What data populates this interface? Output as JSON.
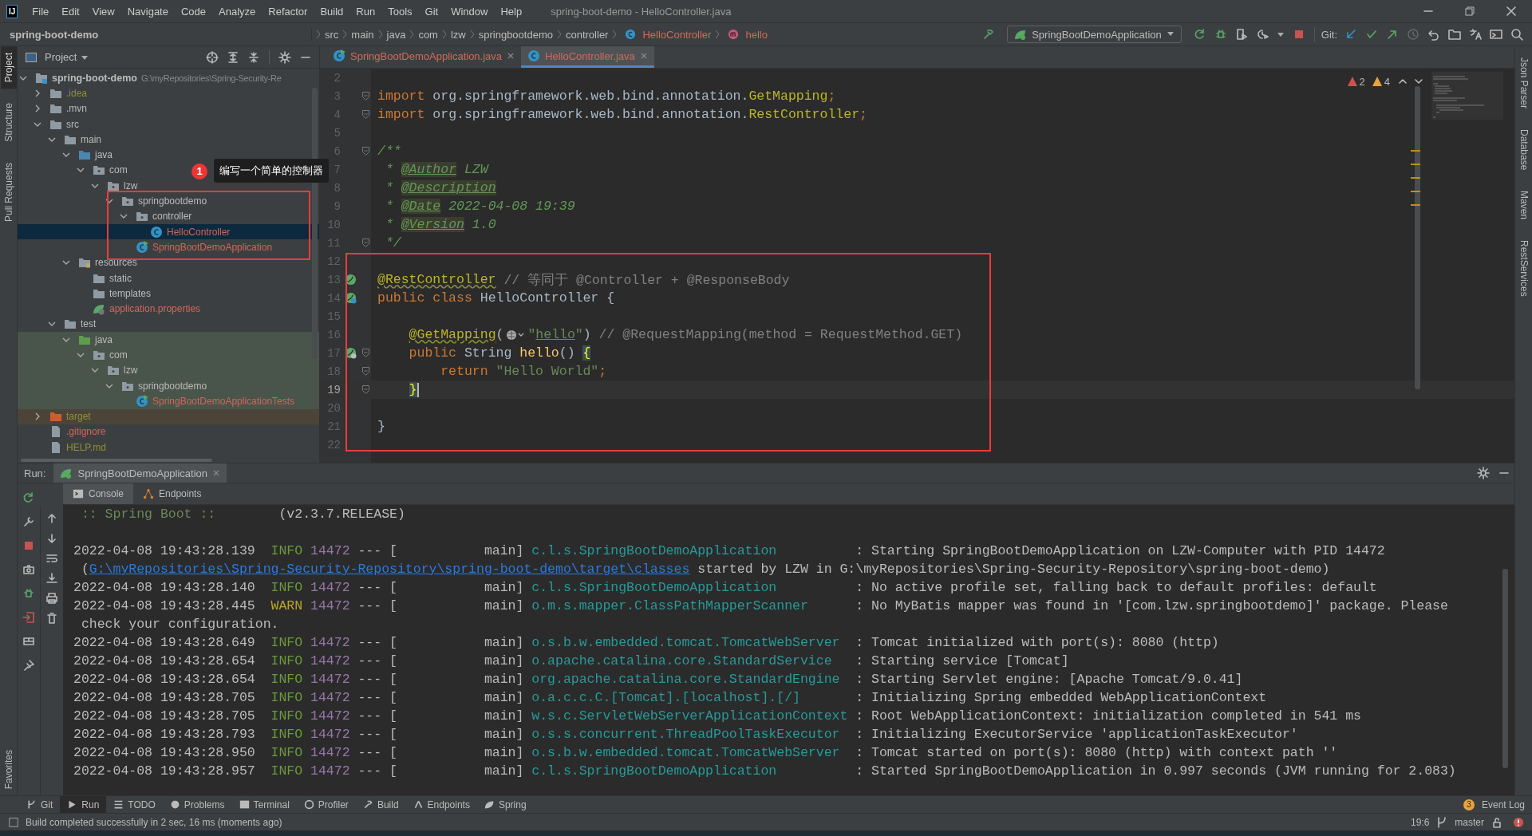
{
  "menu_bar": {
    "logo": "IJ",
    "items": [
      "File",
      "Edit",
      "View",
      "Navigate",
      "Code",
      "Analyze",
      "Refactor",
      "Build",
      "Run",
      "Tools",
      "Git",
      "Window",
      "Help"
    ],
    "title": "spring-boot-demo - HelloController.java"
  },
  "breadcrumbs": [
    {
      "label": "spring-boot-demo",
      "kind": "project"
    },
    {
      "label": "src",
      "kind": "folder"
    },
    {
      "label": "main",
      "kind": "folder"
    },
    {
      "label": "java",
      "kind": "folder"
    },
    {
      "label": "com",
      "kind": "folder"
    },
    {
      "label": "lzw",
      "kind": "folder"
    },
    {
      "label": "springbootdemo",
      "kind": "folder"
    },
    {
      "label": "controller",
      "kind": "folder"
    },
    {
      "label": "HelloController",
      "kind": "class"
    },
    {
      "label": "hello",
      "kind": "method"
    }
  ],
  "toolbar": {
    "run_config": "SpringBootDemoApplication",
    "git_label": "Git:"
  },
  "left_strip": {
    "top": [
      {
        "label": "Project",
        "selected": true
      },
      {
        "label": "Structure",
        "selected": false
      },
      {
        "label": "Pull Requests",
        "selected": false
      }
    ],
    "bottom": [
      {
        "label": "Favorites",
        "selected": false
      }
    ]
  },
  "right_strip": [
    {
      "label": "Json Parser",
      "selected": false
    },
    {
      "label": "Database",
      "selected": false
    },
    {
      "label": "Maven",
      "selected": false
    },
    {
      "label": "RestServices",
      "selected": false
    }
  ],
  "project_panel": {
    "title": "Project",
    "tree": [
      {
        "name": "spring-boot-demo",
        "path": "G:\\myRepositories\\Spring-Security-Re",
        "kind": "module",
        "expanded": true,
        "selected": false,
        "children": [
          {
            "name": ".idea",
            "kind": "folder",
            "ignored": true,
            "expanded": false,
            "selected": false
          },
          {
            "name": ".mvn",
            "kind": "folder",
            "expanded": false,
            "selected": false
          },
          {
            "name": "src",
            "kind": "folder",
            "expanded": true,
            "selected": false,
            "children": [
              {
                "name": "main",
                "kind": "folder",
                "expanded": true,
                "selected": false,
                "children": [
                  {
                    "name": "java",
                    "kind": "source-root",
                    "expanded": true,
                    "selected": false,
                    "children": [
                      {
                        "name": "com",
                        "kind": "package",
                        "expanded": true,
                        "selected": false,
                        "children": [
                          {
                            "name": "lzw",
                            "kind": "package",
                            "expanded": true,
                            "selected": false,
                            "children": [
                              {
                                "name": "springbootdemo",
                                "kind": "package",
                                "expanded": true,
                                "selected": false,
                                "children": [
                                  {
                                    "name": "controller",
                                    "kind": "package",
                                    "expanded": true,
                                    "selected": false,
                                    "children": [
                                      {
                                        "name": "HelloController",
                                        "kind": "class",
                                        "untracked": true,
                                        "selected": true
                                      }
                                    ]
                                  },
                                  {
                                    "name": "SpringBootDemoApplication",
                                    "kind": "spring-class",
                                    "untracked": true,
                                    "selected": false
                                  }
                                ]
                              }
                            ]
                          }
                        ]
                      }
                    ]
                  },
                  {
                    "name": "resources",
                    "kind": "resources-root",
                    "expanded": true,
                    "selected": false,
                    "children": [
                      {
                        "name": "static",
                        "kind": "folder",
                        "selected": false
                      },
                      {
                        "name": "templates",
                        "kind": "folder",
                        "selected": false
                      },
                      {
                        "name": "application.properties",
                        "kind": "spring-properties",
                        "untracked": true,
                        "selected": false
                      }
                    ]
                  }
                ]
              },
              {
                "name": "test",
                "kind": "folder",
                "expanded": true,
                "selected": false,
                "children": [
                  {
                    "name": "java",
                    "kind": "test-root",
                    "in_test": true,
                    "expanded": true,
                    "selected": false,
                    "children": [
                      {
                        "name": "com",
                        "kind": "package",
                        "in_test": true,
                        "expanded": true,
                        "selected": false,
                        "children": [
                          {
                            "name": "lzw",
                            "kind": "package",
                            "in_test": true,
                            "expanded": true,
                            "selected": false,
                            "children": [
                              {
                                "name": "springbootdemo",
                                "kind": "package",
                                "in_test": true,
                                "expanded": true,
                                "selected": false,
                                "children": [
                                  {
                                    "name": "SpringBootDemoApplicationTests",
                                    "kind": "spring-class",
                                    "in_test": true,
                                    "untracked": true,
                                    "selected": false
                                  }
                                ]
                              }
                            ]
                          }
                        ]
                      }
                    ]
                  }
                ]
              }
            ]
          },
          {
            "name": "target",
            "kind": "excluded",
            "ignored": true,
            "expanded": false,
            "selected": false
          },
          {
            "name": ".gitignore",
            "kind": "ignore-file",
            "untracked": true,
            "selected": false
          },
          {
            "name": "HELP.md",
            "kind": "md-file",
            "ignored": true,
            "selected": false
          }
        ]
      }
    ]
  },
  "annotations": [
    {
      "number": "1",
      "text": "编写一个简单的控制器"
    }
  ],
  "editor": {
    "tabs": [
      {
        "label": "SpringBootDemoApplication.java",
        "kind": "spring-class",
        "selected": false
      },
      {
        "label": "HelloController.java",
        "kind": "class",
        "selected": true
      }
    ],
    "problems": [
      {
        "count": "2",
        "kind": "error"
      },
      {
        "count": "4",
        "kind": "warning"
      }
    ],
    "lines": [
      {
        "number": "2"
      },
      {
        "number": "3",
        "fold": true,
        "tokens": [
          {
            "text": "import",
            "kind": "kw"
          },
          {
            "text": " org.springframework.web.bind.annotation.",
            "kind": "plain"
          },
          {
            "text": "GetMapping",
            "kind": "ann"
          },
          {
            "text": ";",
            "kind": "kw"
          }
        ]
      },
      {
        "number": "4",
        "fold": true,
        "tokens": [
          {
            "text": "import",
            "kind": "kw"
          },
          {
            "text": " org.springframework.web.bind.annotation.",
            "kind": "plain"
          },
          {
            "text": "RestController",
            "kind": "ann"
          },
          {
            "text": ";",
            "kind": "kw"
          }
        ]
      },
      {
        "number": "5"
      },
      {
        "number": "6",
        "fold": true,
        "tokens": [
          {
            "text": "/**",
            "kind": "doc"
          }
        ]
      },
      {
        "number": "7",
        "tokens": [
          {
            "text": " * ",
            "kind": "doc"
          },
          {
            "text": "@Author",
            "kind": "doctag"
          },
          {
            "text": " LZW",
            "kind": "doc"
          }
        ]
      },
      {
        "number": "8",
        "tokens": [
          {
            "text": " * ",
            "kind": "doc"
          },
          {
            "text": "@Description",
            "kind": "doctag"
          }
        ]
      },
      {
        "number": "9",
        "tokens": [
          {
            "text": " * ",
            "kind": "doc"
          },
          {
            "text": "@Date",
            "kind": "doctag"
          },
          {
            "text": " 2022-04-08 19:39",
            "kind": "doc"
          }
        ]
      },
      {
        "number": "10",
        "tokens": [
          {
            "text": " * ",
            "kind": "doc"
          },
          {
            "text": "@Version",
            "kind": "doctag"
          },
          {
            "text": " 1.0",
            "kind": "doc"
          }
        ]
      },
      {
        "number": "11",
        "fold": true,
        "tokens": [
          {
            "text": " */",
            "kind": "doc"
          }
        ]
      },
      {
        "number": "12"
      },
      {
        "number": "13",
        "gutter": {
          "kind": "bean"
        },
        "tokens": [
          {
            "text": "@RestController",
            "kind": "ann-wavy"
          },
          {
            "text": " // 等同于 @Controller + @ResponseBody",
            "kind": "cm"
          }
        ]
      },
      {
        "number": "14",
        "gutter": {
          "kind": "bean-linked"
        },
        "tokens": [
          {
            "text": "public class ",
            "kind": "kw"
          },
          {
            "text": "HelloController {",
            "kind": "plain"
          }
        ]
      },
      {
        "number": "15"
      },
      {
        "number": "16",
        "tokens": [
          {
            "text": "    @GetMapping",
            "kind": "ann-wavy"
          },
          {
            "text": "(",
            "kind": "plain"
          },
          {
            "kind": "inlay"
          },
          {
            "text": "\"",
            "kind": "str"
          },
          {
            "text": "hello",
            "kind": "str-link"
          },
          {
            "text": "\"",
            "kind": "str"
          },
          {
            "text": ")",
            "kind": "plain"
          },
          {
            "text": " // @RequestMapping(method = RequestMethod.GET)",
            "kind": "cm"
          }
        ]
      },
      {
        "number": "17",
        "gutter": {
          "kind": "web"
        },
        "fold": true,
        "tokens": [
          {
            "text": "    public ",
            "kind": "kw"
          },
          {
            "text": "String ",
            "kind": "plain"
          },
          {
            "text": "hello",
            "kind": "fn"
          },
          {
            "text": "() ",
            "kind": "plain"
          },
          {
            "text": "{",
            "kind": "brace"
          }
        ]
      },
      {
        "number": "18",
        "fold": true,
        "tokens": [
          {
            "text": "        return ",
            "kind": "kw"
          },
          {
            "text": "\"Hello World\"",
            "kind": "str"
          },
          {
            "text": ";",
            "kind": "kw"
          }
        ]
      },
      {
        "number": "19",
        "fold": true,
        "current": true,
        "tokens": [
          {
            "text": "    }",
            "kind": "brace"
          }
        ]
      },
      {
        "number": "20"
      },
      {
        "number": "21",
        "tokens": [
          {
            "text": "}",
            "kind": "plain"
          }
        ]
      },
      {
        "number": "22"
      }
    ]
  },
  "run_panel": {
    "label": "Run:",
    "tab": "SpringBootDemoApplication",
    "subtabs": [
      {
        "label": "Console",
        "kind": "console",
        "selected": true
      },
      {
        "label": "Endpoints",
        "kind": "endpoints",
        "selected": false
      }
    ],
    "console": [
      {
        "kind": "banner",
        "name": ":: Spring Boot ::",
        "version": "(v2.3.7.RELEASE)"
      },
      {
        "kind": "blank"
      },
      {
        "kind": "log",
        "time": "2022-04-08 19:43:28.139",
        "level": "INFO",
        "pid": "14472",
        "thread": "--- [           main]",
        "logger": "c.l.s.SpringBootDemoApplication",
        "message": ": Starting SpringBootDemoApplication on LZW-Computer with PID 14472"
      },
      {
        "kind": "cont",
        "segments": [
          {
            "text": "(",
            "kind": "plain"
          },
          {
            "text": "G:\\myRepositories\\Spring-Security-Repository\\spring-boot-demo\\target\\classes",
            "kind": "link"
          },
          {
            "text": " started by LZW in G:\\myRepositories\\Spring-Security-Repository\\spring-boot-demo)",
            "kind": "plain"
          }
        ]
      },
      {
        "kind": "log",
        "time": "2022-04-08 19:43:28.140",
        "level": "INFO",
        "pid": "14472",
        "thread": "--- [           main]",
        "logger": "c.l.s.SpringBootDemoApplication",
        "message": ": No active profile set, falling back to default profiles: default"
      },
      {
        "kind": "log",
        "time": "2022-04-08 19:43:28.445",
        "level": "WARN",
        "pid": "14472",
        "thread": "--- [           main]",
        "logger": "o.m.s.mapper.ClassPathMapperScanner",
        "message": ": No MyBatis mapper was found in '[com.lzw.springbootdemo]' package. Please"
      },
      {
        "kind": "cont",
        "segments": [
          {
            "text": "check your configuration.",
            "kind": "plain"
          }
        ]
      },
      {
        "kind": "log",
        "time": "2022-04-08 19:43:28.649",
        "level": "INFO",
        "pid": "14472",
        "thread": "--- [           main]",
        "logger": "o.s.b.w.embedded.tomcat.TomcatWebServer",
        "message": ": Tomcat initialized with port(s): 8080 (http)"
      },
      {
        "kind": "log",
        "time": "2022-04-08 19:43:28.654",
        "level": "INFO",
        "pid": "14472",
        "thread": "--- [           main]",
        "logger": "o.apache.catalina.core.StandardService",
        "message": ": Starting service [Tomcat]"
      },
      {
        "kind": "log",
        "time": "2022-04-08 19:43:28.654",
        "level": "INFO",
        "pid": "14472",
        "thread": "--- [           main]",
        "logger": "org.apache.catalina.core.StandardEngine",
        "message": ": Starting Servlet engine: [Apache Tomcat/9.0.41]"
      },
      {
        "kind": "log",
        "time": "2022-04-08 19:43:28.705",
        "level": "INFO",
        "pid": "14472",
        "thread": "--- [           main]",
        "logger": "o.a.c.c.C.[Tomcat].[localhost].[/]",
        "message": ": Initializing Spring embedded WebApplicationContext"
      },
      {
        "kind": "log",
        "time": "2022-04-08 19:43:28.705",
        "level": "INFO",
        "pid": "14472",
        "thread": "--- [           main]",
        "logger": "w.s.c.ServletWebServerApplicationContext",
        "message": ": Root WebApplicationContext: initialization completed in 541 ms"
      },
      {
        "kind": "log",
        "time": "2022-04-08 19:43:28.793",
        "level": "INFO",
        "pid": "14472",
        "thread": "--- [           main]",
        "logger": "o.s.s.concurrent.ThreadPoolTaskExecutor",
        "message": ": Initializing ExecutorService 'applicationTaskExecutor'"
      },
      {
        "kind": "log",
        "time": "2022-04-08 19:43:28.950",
        "level": "INFO",
        "pid": "14472",
        "thread": "--- [           main]",
        "logger": "o.s.b.w.embedded.tomcat.TomcatWebServer",
        "message": ": Tomcat started on port(s): 8080 (http) with context path ''"
      },
      {
        "kind": "log",
        "time": "2022-04-08 19:43:28.957",
        "level": "INFO",
        "pid": "14472",
        "thread": "--- [           main]",
        "logger": "c.l.s.SpringBootDemoApplication",
        "message": ": Started SpringBootDemoApplication in 0.997 seconds (JVM running for 2.083)"
      }
    ]
  },
  "tool_bar": [
    {
      "label": "Git",
      "kind": "git",
      "selected": false
    },
    {
      "label": "Run",
      "kind": "run",
      "selected": true
    },
    {
      "label": "TODO",
      "kind": "todo",
      "selected": false
    },
    {
      "label": "Problems",
      "kind": "problems",
      "selected": false
    },
    {
      "label": "Terminal",
      "kind": "terminal",
      "selected": false
    },
    {
      "label": "Profiler",
      "kind": "profiler",
      "selected": false
    },
    {
      "label": "Build",
      "kind": "build",
      "selected": false
    },
    {
      "label": "Endpoints",
      "kind": "endpoints",
      "selected": false
    },
    {
      "label": "Spring",
      "kind": "spring",
      "selected": false
    }
  ],
  "event_log": {
    "label": "Event Log",
    "count": "3"
  },
  "status_bar": {
    "message": "Build completed successfully in 2 sec, 16 ms (moments ago)",
    "position": "19:6",
    "branch": "master"
  }
}
